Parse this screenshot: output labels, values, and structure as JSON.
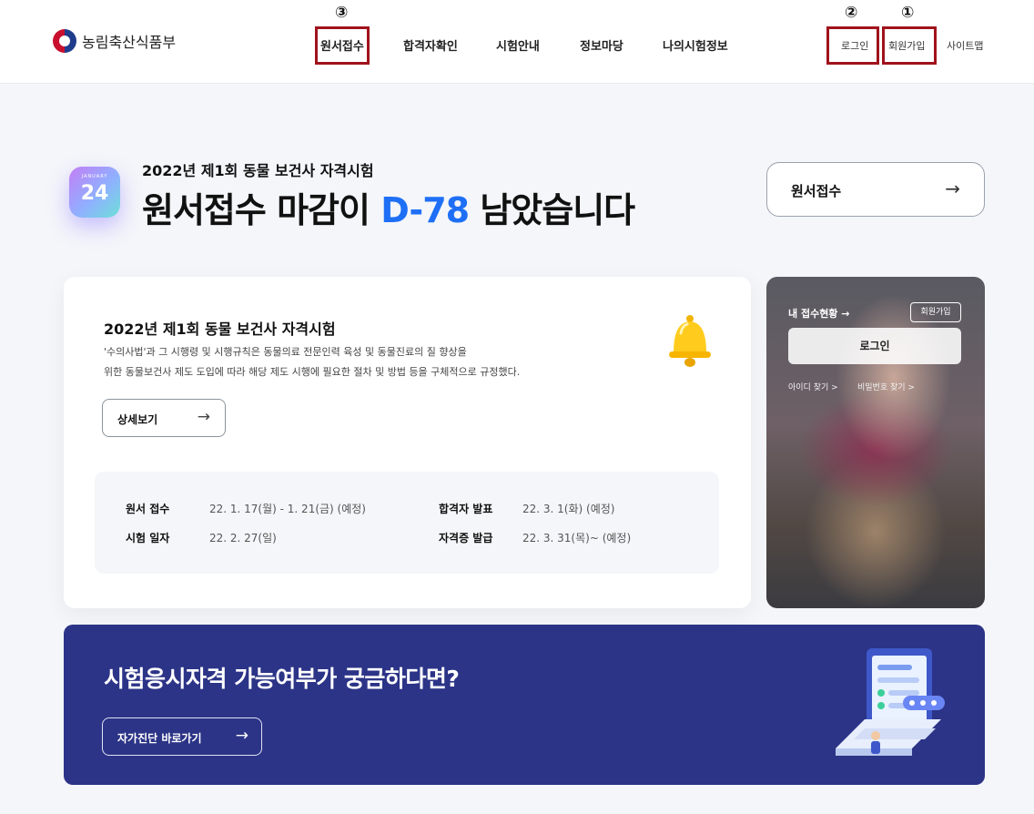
{
  "header": {
    "logo_text": "농림축산식품부",
    "nav": [
      "원서접수",
      "합격자확인",
      "시험안내",
      "정보마당",
      "나의시험정보"
    ],
    "login": "로그인",
    "signup": "회원가입",
    "sitemap": "사이트맵"
  },
  "annotations": {
    "n1": "①",
    "n2": "②",
    "n3": "③"
  },
  "hero": {
    "calendar_month": "JANUARY",
    "calendar_day": "24",
    "subtitle": "2022년 제1회 동물 보건사 자격시험",
    "title_prefix": "원서접수 마감이 ",
    "title_dday": "D-78",
    "title_suffix": " 남았습니다",
    "apply_button": "원서접수",
    "arrow": "→"
  },
  "card": {
    "title": "2022년 제1회 동물 보건사 자격시험",
    "desc_line1": "'수의사법'과 그 시행령 및 시행규칙은 동물의료 전문인력 육성 및 동물진료의 질 향상을",
    "desc_line2": "위한 동물보건사 제도 도입에 따라 해당 제도 시행에 필요한 절차 및 방법 등을 구체적으로 규정했다.",
    "detail_button": "상세보기",
    "schedule": [
      {
        "key": "원서 접수",
        "value": "22. 1. 17(월) - 1. 21(금) (예정)"
      },
      {
        "key": "합격자 발표",
        "value": "22. 3. 1(화) (예정)"
      },
      {
        "key": "시험 일자",
        "value": "22. 2. 27(일)"
      },
      {
        "key": "자격증 발급",
        "value": "22. 3. 31(목)~ (예정)"
      }
    ]
  },
  "photo_panel": {
    "status": "내 접수현황  →",
    "signup": "회원가입",
    "login": "로그인",
    "find_id": "아이디 찾기 >",
    "find_pw": "비밀번호 찾기 >"
  },
  "banner": {
    "title": "시험응시자격 가능여부가 궁금하다면?",
    "button": "자가진단 바로가기"
  },
  "colors": {
    "accent": "#1e6ff5",
    "banner": "#2c3487",
    "annotation": "#a0121c"
  }
}
